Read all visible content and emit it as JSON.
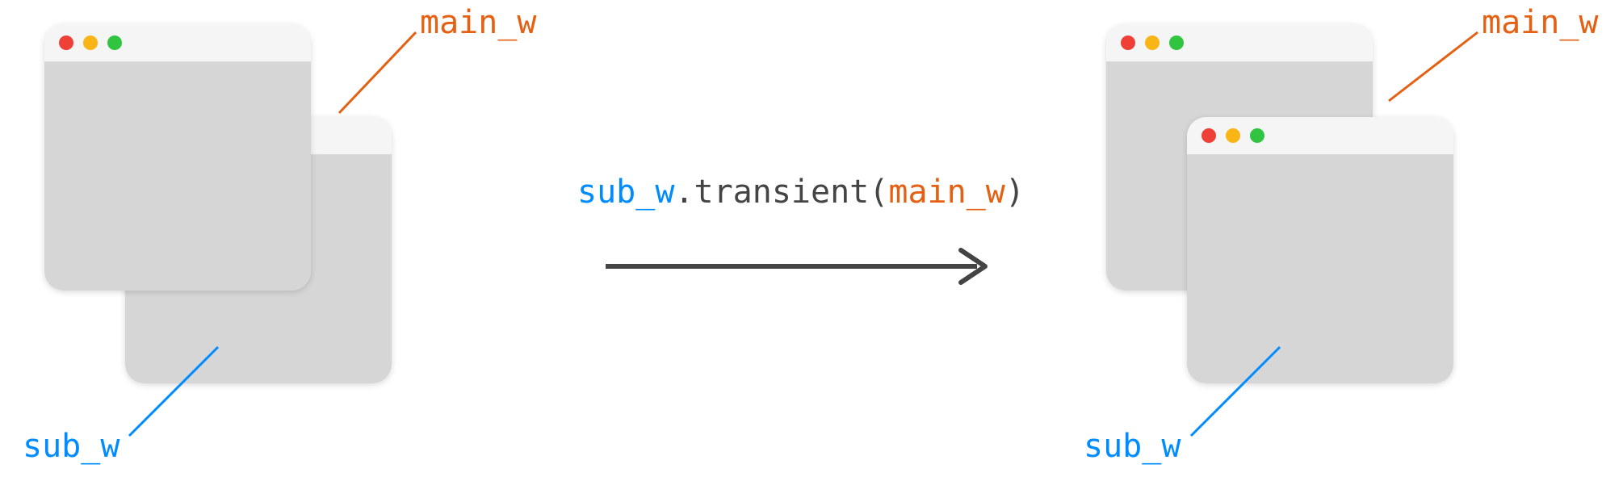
{
  "labels": {
    "main_w_left": "main_w",
    "sub_w_left": "sub_w",
    "main_w_right": "main_w",
    "sub_w_right": "sub_w"
  },
  "code": {
    "sub": "sub_w",
    "dot": ".",
    "fn": "transient",
    "open": "(",
    "main": "main_w",
    "close": ")"
  },
  "colors": {
    "orange": "#e46113",
    "blue": "#008cff",
    "arrow": "#444444"
  }
}
